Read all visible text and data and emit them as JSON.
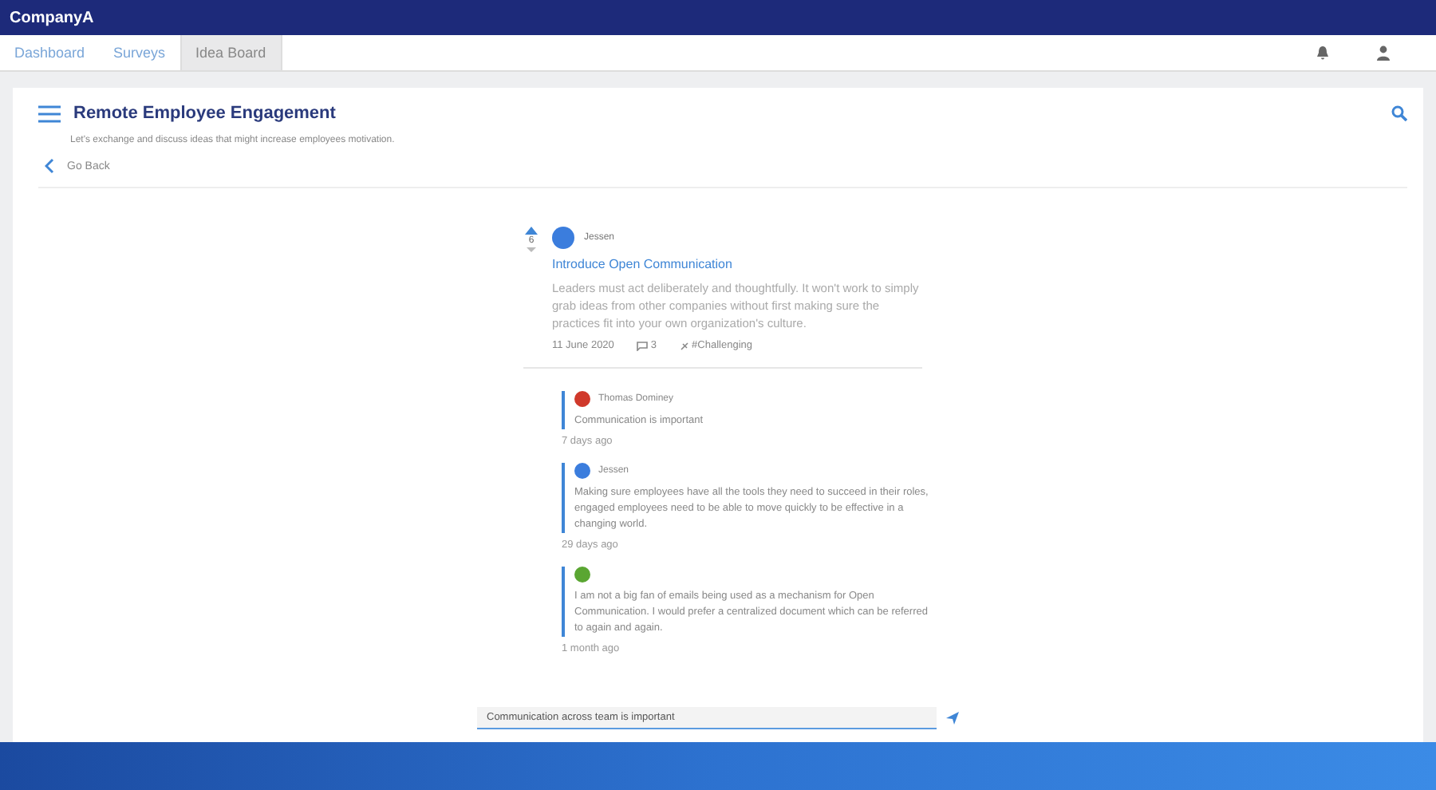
{
  "app_name": "CompanyA",
  "tabs": [
    {
      "label": "Dashboard",
      "selected": false
    },
    {
      "label": "Surveys",
      "selected": false
    },
    {
      "label": "Idea Board",
      "selected": true
    }
  ],
  "board": {
    "title": "Remote Employee Engagement",
    "description": "Let's exchange and discuss ideas that might increase employees motivation.",
    "back_label": "Go Back"
  },
  "post": {
    "votes": "6",
    "author": "Jessen",
    "color": "#3b7ddd",
    "title": "Introduce Open Communication",
    "body": "Leaders must act deliberately and thoughtfully. It won't work to simply grab ideas from other companies without first making sure the practices fit into your own organization's culture.",
    "date": "11 June 2020",
    "comment_count": "3",
    "tag": "#Challenging"
  },
  "comments": [
    {
      "author": "Thomas Dominey",
      "color": "#d0392b",
      "text": "Communication is important",
      "time": "7 days ago"
    },
    {
      "author": "Jessen",
      "color": "#3b7ddd",
      "text": "Making sure employees have all the tools they need to succeed in their roles, engaged employees need to be able to move quickly to be effective in a changing world.",
      "time": "29 days ago"
    },
    {
      "color": "#5aa632",
      "text": "I am not a big fan of emails being used as a mechanism for Open Communication. I would prefer a centralized document which can be referred to again and again.",
      "time": "1 month ago"
    }
  ],
  "reply": {
    "value": "Communication across team is important"
  }
}
